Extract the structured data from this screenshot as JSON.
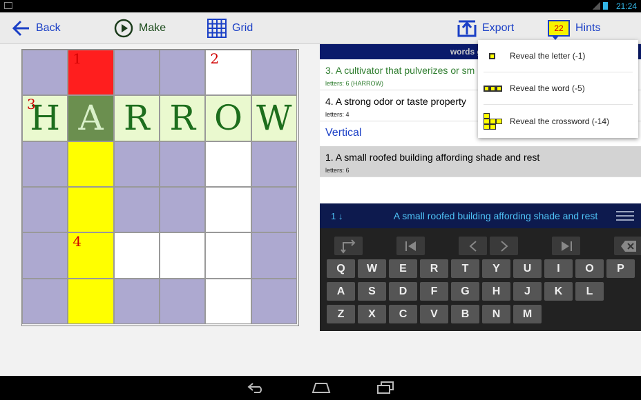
{
  "status": {
    "time": "21:24"
  },
  "toolbar": {
    "back_label": "Back",
    "make_label": "Make",
    "grid_label": "Grid",
    "export_label": "Export",
    "hints_label": "Hints",
    "hints_count": "22"
  },
  "board": {
    "rows": [
      [
        {
          "c": "black"
        },
        {
          "c": "red",
          "n": "1"
        },
        {
          "c": "black"
        },
        {
          "c": "black"
        },
        {
          "c": "white",
          "n": "2"
        },
        {
          "c": "black"
        }
      ],
      [
        {
          "c": "light",
          "n": "3",
          "l": "H"
        },
        {
          "c": "sel",
          "l": "A"
        },
        {
          "c": "light",
          "l": "R"
        },
        {
          "c": "light",
          "l": "R"
        },
        {
          "c": "light",
          "l": "O"
        },
        {
          "c": "light",
          "l": "W"
        }
      ],
      [
        {
          "c": "black"
        },
        {
          "c": "yellow"
        },
        {
          "c": "black"
        },
        {
          "c": "black"
        },
        {
          "c": "white"
        },
        {
          "c": "black"
        }
      ],
      [
        {
          "c": "black"
        },
        {
          "c": "yellow"
        },
        {
          "c": "black"
        },
        {
          "c": "black"
        },
        {
          "c": "white"
        },
        {
          "c": "black"
        }
      ],
      [
        {
          "c": "black"
        },
        {
          "c": "yellow",
          "n": "4"
        },
        {
          "c": "white"
        },
        {
          "c": "white"
        },
        {
          "c": "white"
        },
        {
          "c": "black"
        }
      ],
      [
        {
          "c": "black"
        },
        {
          "c": "yellow"
        },
        {
          "c": "black"
        },
        {
          "c": "black"
        },
        {
          "c": "white"
        },
        {
          "c": "black"
        }
      ]
    ]
  },
  "panel": {
    "header": "words guessed",
    "clues": [
      {
        "text": "3. A cultivator that pulverizes or sm",
        "meta": "letters: 6  (HARROW)"
      },
      {
        "text": "4. A strong odor or taste property",
        "meta": "letters: 4"
      }
    ],
    "vertical_label": "Vertical",
    "vertical_clue": {
      "text": "1. A small roofed building affording shade and rest",
      "meta": "letters: 6"
    }
  },
  "current": {
    "index": "1 ↓",
    "text": "A small roofed building affording shade and rest"
  },
  "keyboard": {
    "row1": [
      "Q",
      "W",
      "E",
      "R",
      "T",
      "Y",
      "U",
      "I",
      "O",
      "P"
    ],
    "row2": [
      "A",
      "S",
      "D",
      "F",
      "G",
      "H",
      "J",
      "K",
      "L"
    ],
    "row3": [
      "Z",
      "X",
      "C",
      "V",
      "B",
      "N",
      "M"
    ]
  },
  "hints_menu": {
    "letter": "Reveal the letter (-1)",
    "word": "Reveal the word (-5)",
    "crossword": "Reveal the crossword (-14)"
  },
  "colors": {
    "accent": "#1a3fc6",
    "header": "#0a1a6b",
    "yellow": "#ffff00",
    "red": "#ff1e1e",
    "black_cell": "#ada9d0"
  }
}
